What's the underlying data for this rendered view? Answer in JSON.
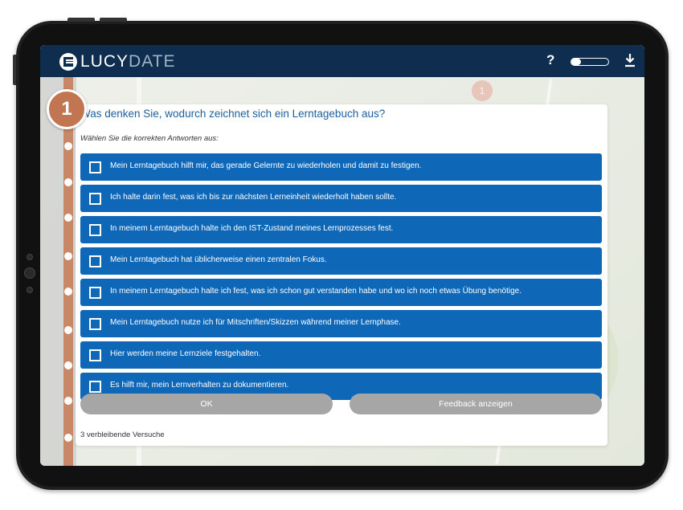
{
  "header": {
    "logo_part1": "LUCY",
    "logo_part2": "DATE",
    "help_label": "?",
    "progress_fraction": 0.25,
    "download_icon": "download-icon"
  },
  "map": {
    "pin_label": "1"
  },
  "step": {
    "number": "1"
  },
  "quiz": {
    "question": "Was denken Sie, wodurch zeichnet sich ein Lerntagebuch aus?",
    "instruction": "Wählen Sie die korrekten Antworten aus:",
    "answers": [
      {
        "label": "Mein Lerntagebuch hilft mir, das gerade Gelernte zu wiederholen und damit zu festigen."
      },
      {
        "label": "Ich halte darin fest, was ich bis zur nächsten Lerneinheit wiederholt haben sollte."
      },
      {
        "label": "In meinem Lerntagebuch halte ich den IST-Zustand meines Lernprozesses fest."
      },
      {
        "label": "Mein Lerntagebuch hat üblicherweise einen zentralen Fokus."
      },
      {
        "label": "In meinem Lerntagebuch halte ich fest, was ich schon gut verstanden habe und wo ich noch etwas Übung benötige."
      },
      {
        "label": "Mein Lerntagebuch nutze ich für Mitschriften/Skizzen während meiner Lernphase."
      },
      {
        "label": "Hier werden meine Lernziele festgehalten."
      },
      {
        "label": "Es hilft mir, mein Lernverhalten zu dokumentieren."
      }
    ],
    "ok_label": "OK",
    "feedback_label": "Feedback anzeigen",
    "attempts_text": "3 verbleibende Versuche"
  },
  "colors": {
    "header_bg": "#0f2d4f",
    "answer_bg": "#0f68b7",
    "question_text": "#1b5f9e",
    "step_badge": "#c17550",
    "button_bg": "#a6a6a6"
  }
}
